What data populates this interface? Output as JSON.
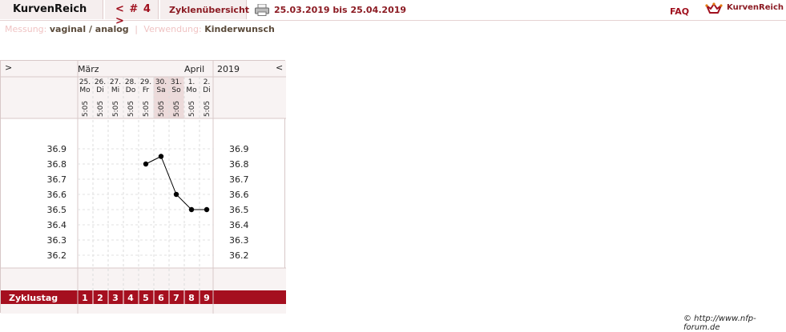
{
  "topbar": {
    "brand": "KurvenReich",
    "cycle_nav": "< # 4 >",
    "overview": "Zyklenübersicht",
    "date_range": "25.03.2019 bis 25.04.2019",
    "faq": "FAQ",
    "logo_text": "KurvenReich",
    "printer_icon": "printer-icon",
    "logo_icon": "crown-icon"
  },
  "info": {
    "measurement_label": "Messung:",
    "measurement_value": "vaginal / analog",
    "separator": "|",
    "usage_label": "Verwendung:",
    "usage_value": "Kinderwunsch"
  },
  "chart_header": {
    "nav_prev": ">",
    "nav_next": "<",
    "month1": "März",
    "month2": "April",
    "year": "2019"
  },
  "days": [
    {
      "d": "25.",
      "wd": "Mo",
      "time": "5:05",
      "weekend": false
    },
    {
      "d": "26.",
      "wd": "Di",
      "time": "5:05",
      "weekend": false
    },
    {
      "d": "27.",
      "wd": "Mi",
      "time": "5:05",
      "weekend": false
    },
    {
      "d": "28.",
      "wd": "Do",
      "time": "5:05",
      "weekend": false
    },
    {
      "d": "29.",
      "wd": "Fr",
      "time": "5:05",
      "weekend": false
    },
    {
      "d": "30.",
      "wd": "Sa",
      "time": "5:05",
      "weekend": true
    },
    {
      "d": "31.",
      "wd": "So",
      "time": "5:05",
      "weekend": true
    },
    {
      "d": "1.",
      "wd": "Mo",
      "time": "5:05",
      "weekend": false
    },
    {
      "d": "2.",
      "wd": "Di",
      "time": "5:05",
      "weekend": false
    }
  ],
  "cycle_row": {
    "label": "Zyklustag",
    "days": [
      "1",
      "2",
      "3",
      "4",
      "5",
      "6",
      "7",
      "8",
      "9"
    ]
  },
  "colors": {
    "accent": "#a0101e",
    "cycle_bar": "#a50f1f",
    "weekend": "#ecdada"
  },
  "chart_data": {
    "type": "line",
    "x": [
      "25.",
      "26.",
      "27.",
      "28.",
      "29.",
      "30.",
      "31.",
      "1.",
      "2."
    ],
    "cycle_days": [
      1,
      2,
      3,
      4,
      5,
      6,
      7,
      8,
      9
    ],
    "values": [
      null,
      null,
      null,
      null,
      36.8,
      36.85,
      36.6,
      36.5,
      36.5
    ],
    "yticks": [
      "36.9",
      "36.8",
      "36.7",
      "36.6",
      "36.5",
      "36.4",
      "36.3",
      "36.2"
    ],
    "ylim": [
      36.2,
      36.9
    ],
    "grid": true
  },
  "footer": {
    "copyright": "© http://www.nfp-forum.de"
  }
}
